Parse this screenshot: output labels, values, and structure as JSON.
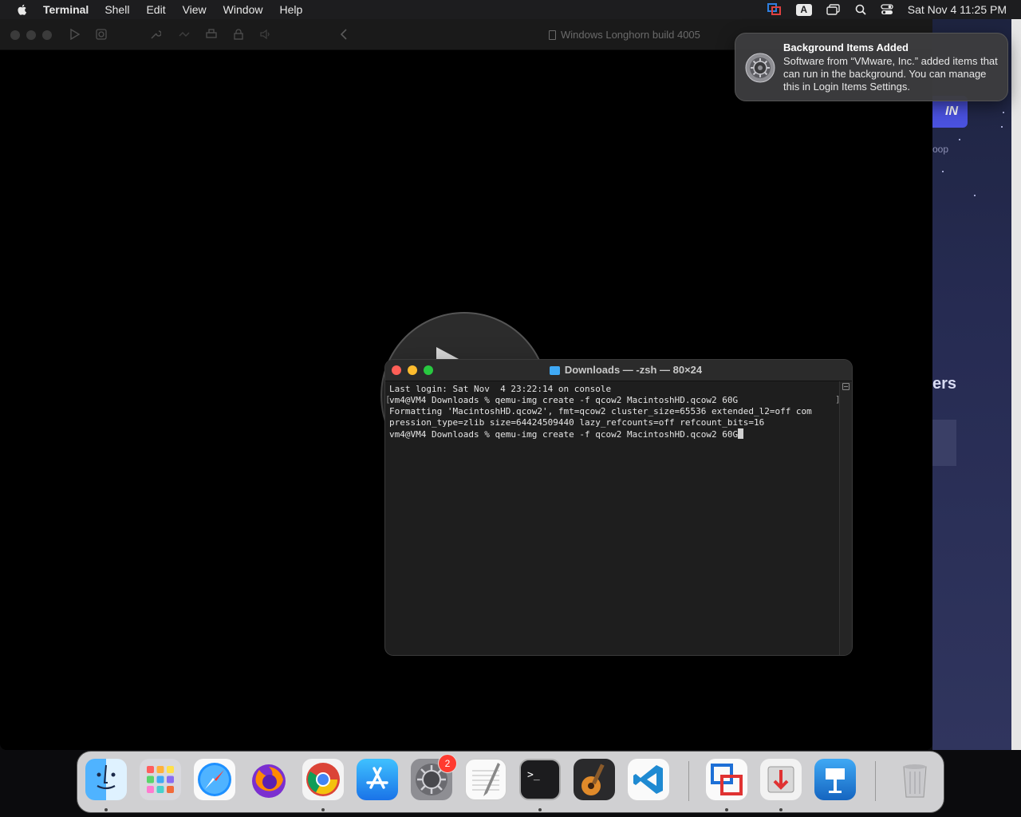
{
  "menubar": {
    "app_name": "Terminal",
    "items": [
      "Shell",
      "Edit",
      "View",
      "Window",
      "Help"
    ],
    "input_indicator": "A",
    "clock": "Sat Nov 4  11:25 PM"
  },
  "vmware": {
    "window_title": "Windows Longhorn build 4005"
  },
  "terminal": {
    "title": "Downloads — -zsh — 80×24",
    "lines": [
      "Last login: Sat Nov  4 23:22:14 on console",
      "vm4@VM4 Downloads % qemu-img create -f qcow2 MacintoshHD.qcow2 60G",
      "Formatting 'MacintoshHD.qcow2', fmt=qcow2 cluster_size=65536 extended_l2=off com",
      "pression_type=zlib size=64424509440 lazy_refcounts=off refcount_bits=16",
      "vm4@VM4 Downloads % qemu-img create -f qcow2 MacintoshHD.qcow2 60G"
    ]
  },
  "notification": {
    "title": "Background Items Added",
    "body": "Software from “VMware, Inc.” added items that can run in the background. You can manage this in Login Items Settings."
  },
  "browser": {
    "button_fragment": "IN",
    "text_fragment": "oop",
    "heading_fragment": "ers"
  },
  "dock": {
    "apps": [
      {
        "name": "finder-icon",
        "running": true
      },
      {
        "name": "launchpad-icon",
        "running": false
      },
      {
        "name": "safari-icon",
        "running": false
      },
      {
        "name": "firefox-icon",
        "running": false
      },
      {
        "name": "chrome-icon",
        "running": true
      },
      {
        "name": "app-store-icon",
        "running": false
      },
      {
        "name": "system-settings-icon",
        "running": false,
        "badge": "2"
      },
      {
        "name": "textedit-icon",
        "running": false
      },
      {
        "name": "terminal-icon",
        "running": true
      },
      {
        "name": "garageband-icon",
        "running": false
      },
      {
        "name": "vscode-icon",
        "running": false
      },
      {
        "name": "vmware-fusion-icon",
        "running": true
      },
      {
        "name": "installer-icon",
        "running": true
      },
      {
        "name": "keynote-icon",
        "running": false
      },
      {
        "name": "trash-icon",
        "running": false
      }
    ]
  },
  "colors": {
    "close": "#ff5f57",
    "minimize": "#febc2e",
    "zoom": "#28c840",
    "badge": "#ff3b30"
  }
}
